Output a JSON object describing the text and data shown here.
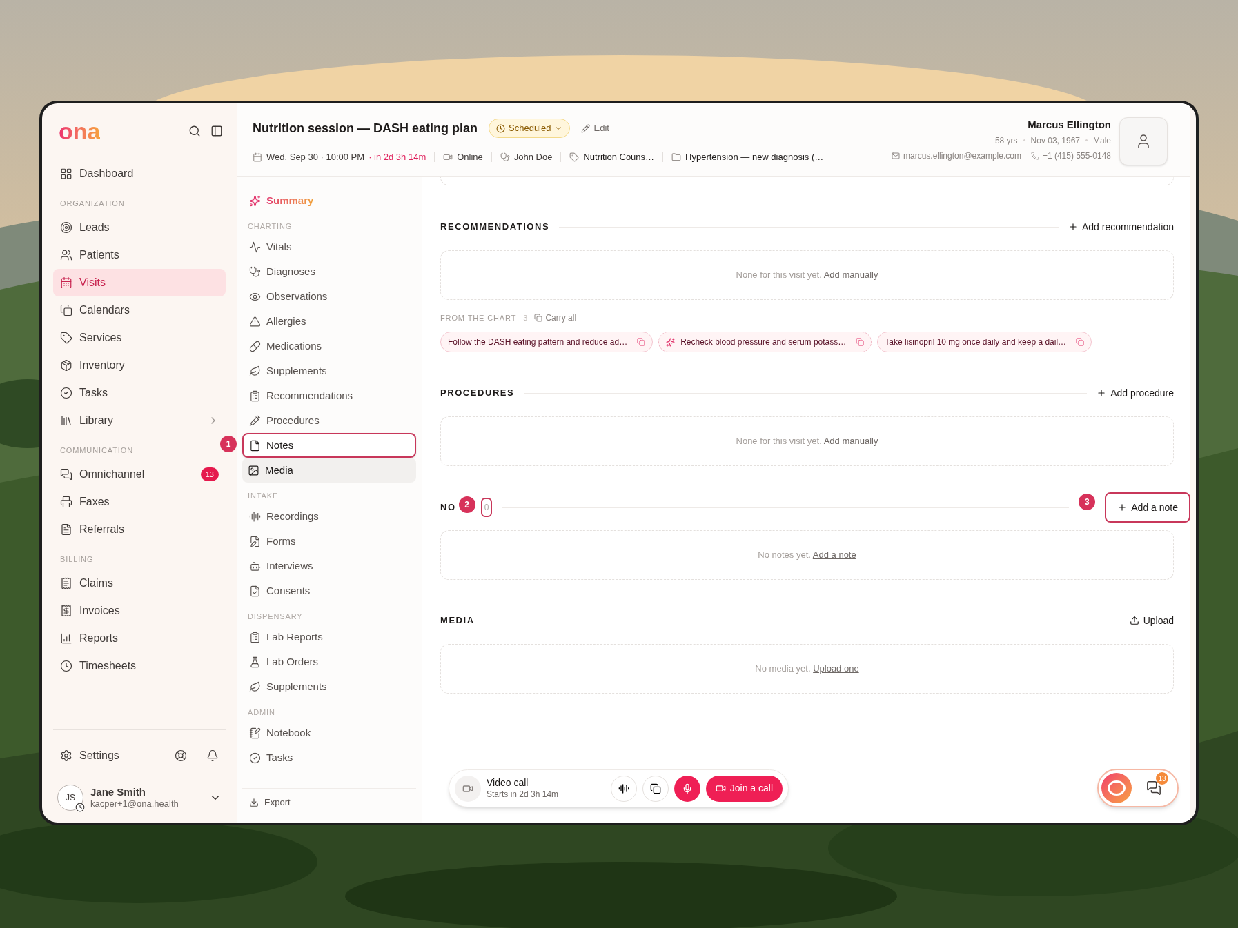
{
  "sidebar": {
    "logo": "ona",
    "groups": [
      {
        "items": [
          {
            "label": "Dashboard",
            "selected": false,
            "submenu": false
          }
        ]
      },
      {
        "heading": "ORGANIZATION",
        "items": [
          {
            "label": "Leads",
            "selected": false,
            "submenu": false
          },
          {
            "label": "Patients",
            "selected": false,
            "submenu": false
          },
          {
            "label": "Visits",
            "selected": true,
            "submenu": false
          },
          {
            "label": "Calendars",
            "selected": false,
            "submenu": false
          },
          {
            "label": "Services",
            "selected": false,
            "submenu": false
          },
          {
            "label": "Inventory",
            "selected": false,
            "submenu": false
          },
          {
            "label": "Tasks",
            "selected": false,
            "submenu": false
          },
          {
            "label": "Library",
            "selected": false,
            "submenu": true
          }
        ]
      },
      {
        "heading": "COMMUNICATION",
        "items": [
          {
            "label": "Omnichannel",
            "selected": false,
            "submenu": false,
            "badge": "13"
          },
          {
            "label": "Faxes",
            "selected": false,
            "submenu": false
          },
          {
            "label": "Referrals",
            "selected": false,
            "submenu": false
          }
        ]
      },
      {
        "heading": "BILLING",
        "items": [
          {
            "label": "Claims",
            "selected": false,
            "submenu": false
          },
          {
            "label": "Invoices",
            "selected": false,
            "submenu": false
          },
          {
            "label": "Reports",
            "selected": false,
            "submenu": false
          },
          {
            "label": "Timesheets",
            "selected": false,
            "submenu": false
          }
        ]
      }
    ],
    "settings": "Settings",
    "user": {
      "initials": "JS",
      "name": "Jane Smith",
      "email": "kacper+1@ona.health"
    }
  },
  "header": {
    "title": "Nutrition session — DASH eating plan",
    "status": "Scheduled",
    "edit": "Edit",
    "date": "Wed, Sep 30 · 10:00 PM",
    "countdown": "· in 2d 3h 14m",
    "mode": "Online",
    "provider": "John Doe",
    "service": "Nutrition Couns…",
    "case": "Hypertension — new diagnosis (…"
  },
  "patient": {
    "name": "Marcus Ellington",
    "age": "58 yrs",
    "dob": "Nov 03, 1967",
    "sex": "Male",
    "email": "marcus.ellington@example.com",
    "phone": "+1 (415) 555-0148"
  },
  "section_nav": {
    "groups": [
      {
        "items": [
          {
            "label": "Summary",
            "selected": true,
            "kind": "plain"
          }
        ]
      },
      {
        "heading": "CHARTING",
        "items": [
          {
            "label": "Vitals",
            "selected": false,
            "kind": "plain"
          },
          {
            "label": "Diagnoses",
            "selected": false,
            "kind": "plain"
          },
          {
            "label": "Observations",
            "selected": false,
            "kind": "plain"
          },
          {
            "label": "Allergies",
            "selected": false,
            "kind": "plain"
          },
          {
            "label": "Medications",
            "selected": false,
            "kind": "plain"
          },
          {
            "label": "Supplements",
            "selected": false,
            "kind": "plain"
          },
          {
            "label": "Recommendations",
            "selected": false,
            "kind": "plain"
          },
          {
            "label": "Procedures",
            "selected": false,
            "kind": "plain"
          },
          {
            "label": "Notes",
            "selected": false,
            "kind": "outlined",
            "callout": "1"
          },
          {
            "label": "Media",
            "selected": false,
            "kind": "hovered"
          }
        ]
      },
      {
        "heading": "INTAKE",
        "items": [
          {
            "label": "Recordings",
            "selected": false,
            "kind": "plain"
          },
          {
            "label": "Forms",
            "selected": false,
            "kind": "plain"
          },
          {
            "label": "Interviews",
            "selected": false,
            "kind": "plain"
          },
          {
            "label": "Consents",
            "selected": false,
            "kind": "plain"
          }
        ]
      },
      {
        "heading": "DISPENSARY",
        "items": [
          {
            "label": "Lab Reports",
            "selected": false,
            "kind": "plain"
          },
          {
            "label": "Lab Orders",
            "selected": false,
            "kind": "plain"
          },
          {
            "label": "Supplements",
            "selected": false,
            "kind": "plain"
          }
        ]
      },
      {
        "heading": "ADMIN",
        "items": [
          {
            "label": "Notebook",
            "selected": false,
            "kind": "plain"
          },
          {
            "label": "Tasks",
            "selected": false,
            "kind": "plain"
          }
        ]
      }
    ],
    "export": "Export"
  },
  "sections": [
    {
      "title": "RECOMMENDATIONS",
      "action": "Add recommendation",
      "kind": "add",
      "action_highlighted": false,
      "empty": "None for this visit yet.",
      "empty_link": "Add manually",
      "from_chart": {
        "label": "FROM THE CHART",
        "count": "3",
        "action": "Carry all",
        "chips": [
          {
            "kind": "chart",
            "text": "Follow the DASH eating pattern and reduce ad…"
          },
          {
            "kind": "suggested",
            "text": "Recheck blood pressure and serum potass…"
          },
          {
            "kind": "chart",
            "text": "Take lisinopril 10 mg once daily and keep a dail…"
          }
        ]
      }
    },
    {
      "title": "PROCEDURES",
      "action": "Add procedure",
      "kind": "add",
      "action_highlighted": false,
      "empty": "None for this visit yet.",
      "empty_link": "Add manually"
    },
    {
      "title": "NO",
      "title_callout": "2",
      "count": "0",
      "action": "Add a note",
      "kind": "add",
      "action_highlighted": true,
      "action_callout": "3",
      "empty": "No notes yet.",
      "empty_link": "Add a note"
    },
    {
      "title": "MEDIA",
      "action": "Upload",
      "kind": "upload",
      "action_highlighted": false,
      "empty": "No media yet.",
      "empty_link": "Upload one"
    }
  ],
  "call_bar": {
    "title": "Video call",
    "subtitle": "Starts in 2d 3h 14m",
    "join": "Join a call"
  },
  "assistant": {
    "badge": "13"
  }
}
